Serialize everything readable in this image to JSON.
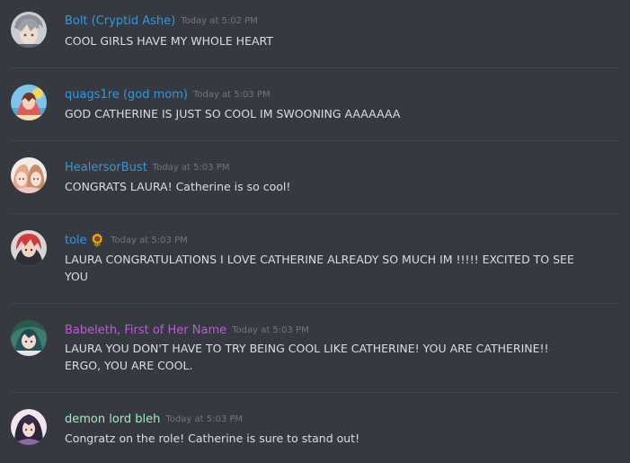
{
  "messages": [
    {
      "username": "Bolt (Cryptid Ashe)",
      "username_color": "#3498db",
      "emoji": "",
      "timestamp": "Today at 5:02 PM",
      "content": "COOL GIRLS HAVE MY WHOLE HEART"
    },
    {
      "username": "quags1re (god mom)",
      "username_color": "#3498db",
      "emoji": "",
      "timestamp": "Today at 5:03 PM",
      "content": "GOD CATHERINE IS JUST SO COOL IM SWOONING AAAAAAA"
    },
    {
      "username": "HealersorBust",
      "username_color": "#3498db",
      "emoji": "",
      "timestamp": "Today at 5:03 PM",
      "content": "CONGRATS LAURA! Catherine is so cool!"
    },
    {
      "username": "tole",
      "username_color": "#3498db",
      "emoji": "🌻",
      "timestamp": "Today at 5:03 PM",
      "content": "LAURA CONGRATULATIONS I LOVE CATHERINE ALREADY SO MUCH IM !!!!! EXCITED TO SEE YOU"
    },
    {
      "username": "Babeleth, First of Her Name",
      "username_color": "#b65fcf",
      "emoji": "",
      "timestamp": "Today at 5:03 PM",
      "content": "LAURA YOU DON'T HAVE TO TRY BEING COOL LIKE CATHERINE! YOU ARE CATHERINE!! ERGO, YOU ARE COOL."
    },
    {
      "username": "demon lord bleh",
      "username_color": "#a3e9c6",
      "emoji": "",
      "timestamp": "Today at 5:03 PM",
      "content": "Congratz on the role! Catherine is sure to stand out!"
    }
  ],
  "colors": {
    "background": "#36393f",
    "divider": "#42454a",
    "text": "#dcddde",
    "timestamp": "#72767d"
  }
}
